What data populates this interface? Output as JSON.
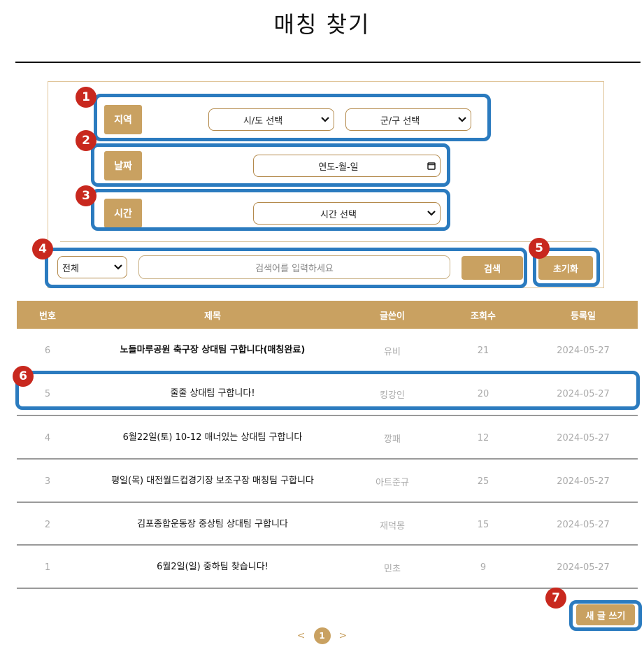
{
  "page": {
    "title": "매칭 찾기"
  },
  "filters": {
    "region": {
      "label": "지역",
      "province_placeholder": "시/도 선택",
      "district_placeholder": "군/구 선택"
    },
    "date": {
      "label": "날짜",
      "placeholder": "연도-월-일"
    },
    "time": {
      "label": "시간",
      "placeholder": "시간 선택"
    }
  },
  "search": {
    "scope_selected": "전체",
    "placeholder": "검색어를 입력하세요",
    "search_button": "검색",
    "reset_button": "초기화"
  },
  "table": {
    "headers": [
      "번호",
      "제목",
      "글쓴이",
      "조회수",
      "등록일"
    ],
    "rows": [
      {
        "no": "6",
        "title": "노들마루공원 축구장 상대팀 구합니다(매칭완료)",
        "author": "유비",
        "views": "21",
        "date": "2024-05-27"
      },
      {
        "no": "5",
        "title": "줄줄 상대팀 구합니다!",
        "author": "킹강인",
        "views": "20",
        "date": "2024-05-27"
      },
      {
        "no": "4",
        "title": "6월22일(토) 10-12 매너있는 상대팀 구합니다",
        "author": "깡패",
        "views": "12",
        "date": "2024-05-27"
      },
      {
        "no": "3",
        "title": "평일(목) 대전월드컵경기장 보조구장 매칭팀 구합니다",
        "author": "아트준규",
        "views": "25",
        "date": "2024-05-27"
      },
      {
        "no": "2",
        "title": "김포종합운동장 중상팀 상대팀 구합니다",
        "author": "재덕몽",
        "views": "15",
        "date": "2024-05-27"
      },
      {
        "no": "1",
        "title": "6월2일(일) 중하팀 찾습니다!",
        "author": "민초",
        "views": "9",
        "date": "2024-05-27"
      }
    ]
  },
  "write_button": "새 글 쓰기",
  "pagination": {
    "prev": "<",
    "current": "1",
    "next": ">"
  },
  "annotations": [
    "1",
    "2",
    "3",
    "4",
    "5",
    "6",
    "7"
  ],
  "colors": {
    "accent": "#c9a161",
    "highlight": "#2b7bbf",
    "badge": "#c8281e"
  }
}
